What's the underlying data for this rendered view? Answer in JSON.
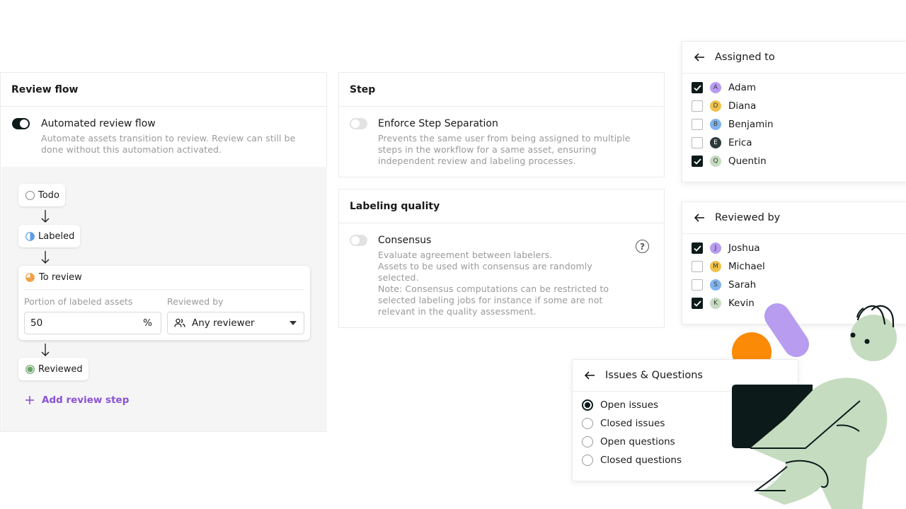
{
  "review_flow": {
    "title": "Review flow",
    "automated_label": "Automated review flow",
    "automated_desc_1": "Automate assets transition to review. Review can still be",
    "automated_desc_2": "done without this automation activated.",
    "automated_enabled": true,
    "statuses": {
      "todo": "Todo",
      "labeled": "Labeled",
      "to_review": "To review",
      "reviewed": "Reviewed"
    },
    "portion_label": "Portion of labeled assets",
    "portion_value": "50",
    "portion_unit": "%",
    "reviewed_by_label": "Reviewed by",
    "reviewer_value": "Any reviewer",
    "add_step_label": "Add review step"
  },
  "step": {
    "title": "Step",
    "option_label": "Enforce Step Separation",
    "enabled": false,
    "desc_1": "Prevents the same user from being assigned to multiple",
    "desc_2": "steps in the workflow for a same asset, ensuring",
    "desc_3": "independent review and labeling processes."
  },
  "labeling_quality": {
    "title": "Labeling quality",
    "option_label": "Consensus",
    "enabled": false,
    "desc_1": "Evaluate agreement between labelers.",
    "desc_2": "Assets to be used with consensus are randomly",
    "desc_3": "selected.",
    "desc_4": "Note: Consensus computations can be restricted to",
    "desc_5": "selected labeling jobs for instance if some are not",
    "desc_6": "relevant in the quality assessment.",
    "help_glyph": "?"
  },
  "assigned_to": {
    "title": "Assigned to",
    "users": [
      {
        "initial": "A",
        "name": "Adam",
        "checked": true,
        "color": "#b79cf0"
      },
      {
        "initial": "D",
        "name": "Diana",
        "checked": false,
        "color": "#f0c24a"
      },
      {
        "initial": "B",
        "name": "Benjamin",
        "checked": false,
        "color": "#7fb3ee"
      },
      {
        "initial": "E",
        "name": "Erica",
        "checked": false,
        "color": "#2b3a3a"
      },
      {
        "initial": "Q",
        "name": "Quentin",
        "checked": true,
        "color": "#c6dcc0"
      }
    ]
  },
  "reviewed_by": {
    "title": "Reviewed by",
    "users": [
      {
        "initial": "J",
        "name": "Joshua",
        "checked": true,
        "color": "#b79cf0"
      },
      {
        "initial": "M",
        "name": "Michael",
        "checked": false,
        "color": "#f0c24a"
      },
      {
        "initial": "S",
        "name": "Sarah",
        "checked": false,
        "color": "#7fb3ee"
      },
      {
        "initial": "K",
        "name": "Kevin",
        "checked": true,
        "color": "#c6dcc0"
      }
    ]
  },
  "issues": {
    "title": "Issues & Questions",
    "options": [
      {
        "label": "Open issues",
        "selected": true
      },
      {
        "label": "Closed issues",
        "selected": false
      },
      {
        "label": "Open questions",
        "selected": false
      },
      {
        "label": "Closed questions",
        "selected": false
      }
    ]
  },
  "colors": {
    "accent_purple": "#8a52d6",
    "dark": "#0d1a1a",
    "sage": "#c6dcc0",
    "orange": "#fb8a06",
    "lavender": "#b79cf0"
  }
}
